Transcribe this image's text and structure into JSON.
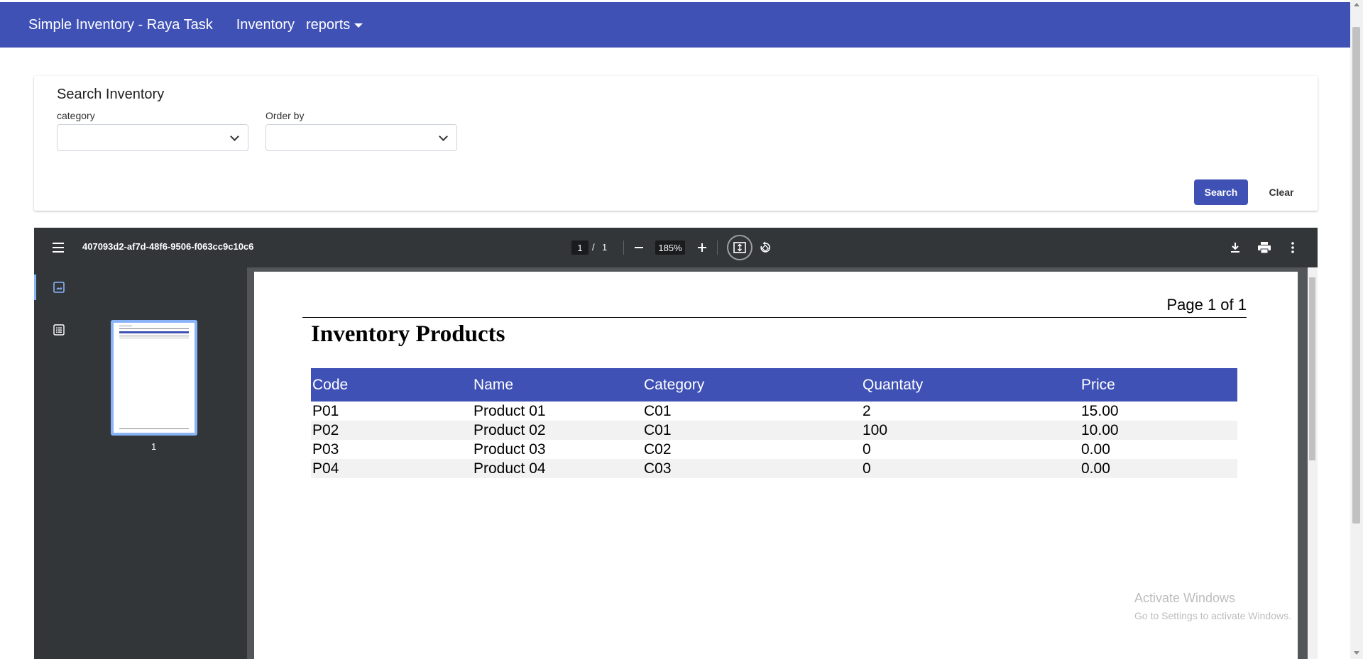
{
  "navbar": {
    "brand": "Simple Inventory - Raya Task",
    "inventory_link": "Inventory",
    "reports_label": "reports",
    "color": "#3f51b5"
  },
  "search_card": {
    "title": "Search Inventory",
    "category_label": "category",
    "category_value": "",
    "order_by_label": "Order by",
    "order_by_value": "",
    "search_button": "Search",
    "clear_button": "Clear"
  },
  "pdf_viewer": {
    "document_name": "407093d2-af7d-48f6-9506-f063cc9c10c6",
    "current_page": "1",
    "page_separator": "/",
    "total_pages": "1",
    "zoom": "185%",
    "thumbnail_page_number": "1",
    "icons": [
      "menu-icon",
      "zoom-out-icon",
      "zoom-in-icon",
      "fit-page-icon",
      "rotate-icon",
      "download-icon",
      "print-icon",
      "more-vert-icon",
      "thumbnails-icon",
      "outline-icon"
    ]
  },
  "report": {
    "page_label": "Page 1 of 1",
    "title": "Inventory Products",
    "columns": [
      "Code",
      "Name",
      "Category",
      "Quantaty",
      "Price"
    ],
    "rows": [
      [
        "P01",
        "Product 01",
        "C01",
        "2",
        "15.00"
      ],
      [
        "P02",
        "Product 02",
        "C01",
        "100",
        "10.00"
      ],
      [
        "P03",
        "Product 03",
        "C02",
        "0",
        "0.00"
      ],
      [
        "P04",
        "Product 04",
        "C03",
        "0",
        "0.00"
      ]
    ]
  },
  "watermark": {
    "line1": "Activate Windows",
    "line2": "Go to Settings to activate Windows."
  }
}
